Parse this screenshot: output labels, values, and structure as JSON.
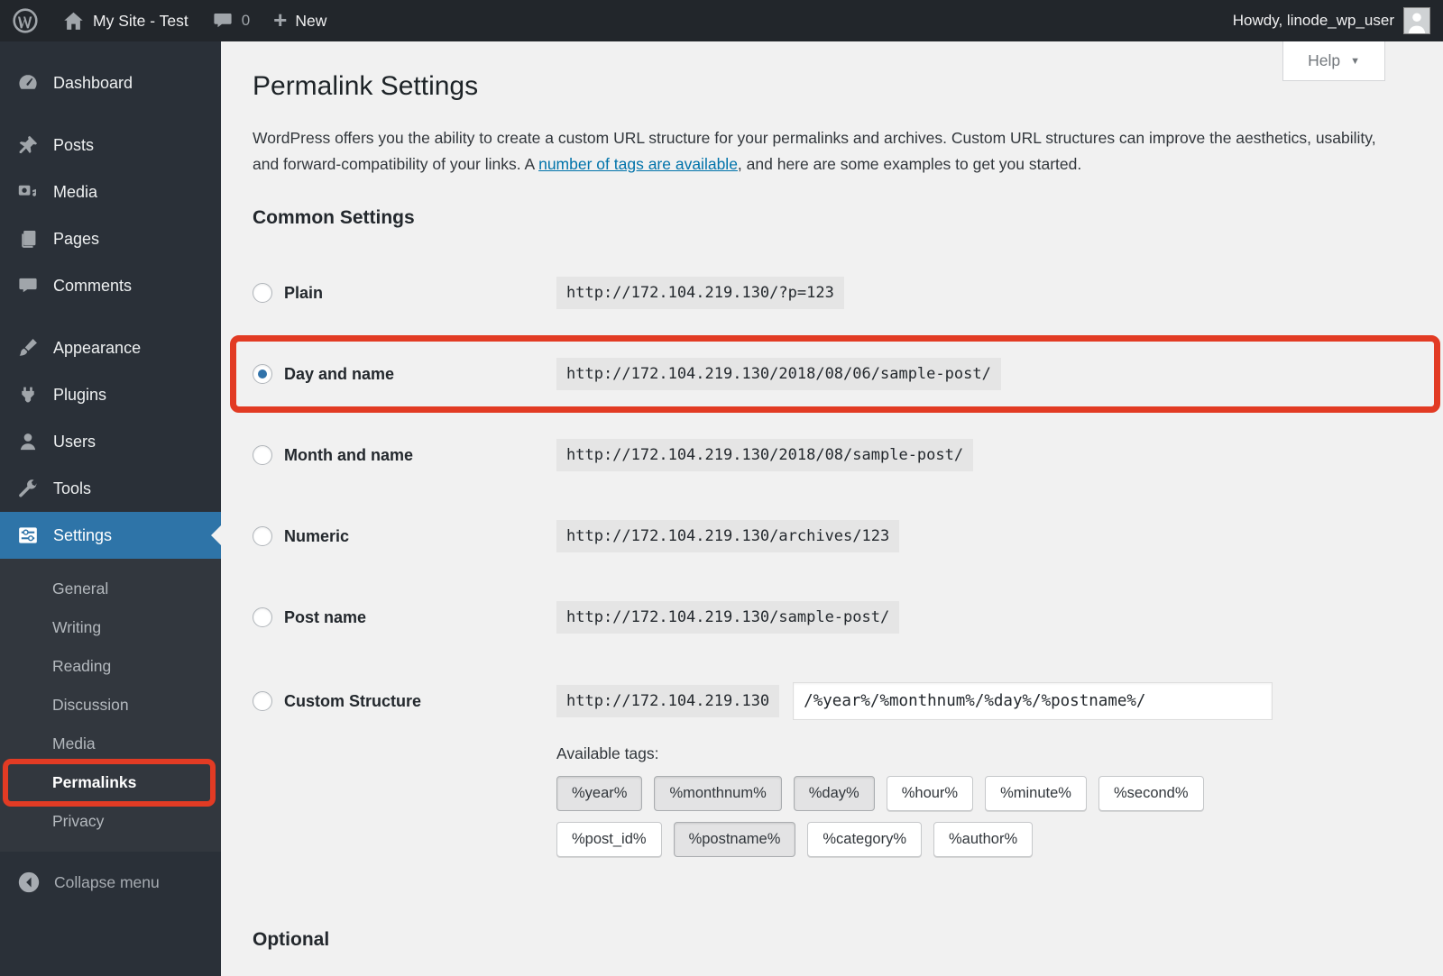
{
  "admin_bar": {
    "site_name": "My Site - Test",
    "comment_count": "0",
    "new_label": "New",
    "howdy": "Howdy, linode_wp_user"
  },
  "sidebar": {
    "items": [
      {
        "label": "Dashboard"
      },
      {
        "label": "Posts"
      },
      {
        "label": "Media"
      },
      {
        "label": "Pages"
      },
      {
        "label": "Comments"
      },
      {
        "label": "Appearance"
      },
      {
        "label": "Plugins"
      },
      {
        "label": "Users"
      },
      {
        "label": "Tools"
      },
      {
        "label": "Settings"
      }
    ],
    "submenu": [
      "General",
      "Writing",
      "Reading",
      "Discussion",
      "Media",
      "Permalinks",
      "Privacy"
    ],
    "collapse_label": "Collapse menu"
  },
  "page": {
    "help_label": "Help",
    "title": "Permalink Settings",
    "intro_before_link": "WordPress offers you the ability to create a custom URL structure for your permalinks and archives. Custom URL structures can improve the aesthetics, usability, and forward-compatibility of your links. A ",
    "intro_link": "number of tags are available",
    "intro_after_link": ", and here are some examples to get you started.",
    "common_settings_heading": "Common Settings",
    "options": [
      {
        "label": "Plain",
        "example": "http://172.104.219.130/?p=123",
        "selected": false,
        "highlighted": false
      },
      {
        "label": "Day and name",
        "example": "http://172.104.219.130/2018/08/06/sample-post/",
        "selected": true,
        "highlighted": true
      },
      {
        "label": "Month and name",
        "example": "http://172.104.219.130/2018/08/sample-post/",
        "selected": false,
        "highlighted": false
      },
      {
        "label": "Numeric",
        "example": "http://172.104.219.130/archives/123",
        "selected": false,
        "highlighted": false
      },
      {
        "label": "Post name",
        "example": "http://172.104.219.130/sample-post/",
        "selected": false,
        "highlighted": false
      },
      {
        "label": "Custom Structure",
        "example_prefix": "http://172.104.219.130",
        "input_value": "/%year%/%monthnum%/%day%/%postname%/",
        "selected": false,
        "highlighted": false
      }
    ],
    "available_tags_label": "Available tags:",
    "tags": [
      {
        "label": "%year%",
        "used": true
      },
      {
        "label": "%monthnum%",
        "used": true
      },
      {
        "label": "%day%",
        "used": true
      },
      {
        "label": "%hour%",
        "used": false
      },
      {
        "label": "%minute%",
        "used": false
      },
      {
        "label": "%second%",
        "used": false
      },
      {
        "label": "%post_id%",
        "used": false
      },
      {
        "label": "%postname%",
        "used": true
      },
      {
        "label": "%category%",
        "used": false
      },
      {
        "label": "%author%",
        "used": false
      }
    ],
    "optional_heading": "Optional"
  },
  "icons": {
    "new_plus": "+",
    "help_caret": "▼"
  },
  "colors": {
    "menu_accent": "#2e74a8",
    "annotation_red": "#e23b24",
    "link": "#0073aa"
  }
}
